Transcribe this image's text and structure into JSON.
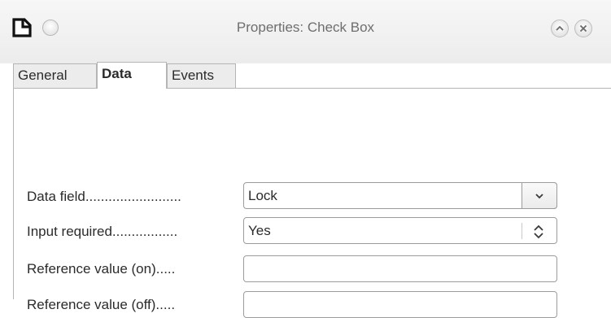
{
  "window": {
    "title": "Properties: Check Box",
    "app_icon": "document-corner-icon",
    "menu_icon": "circle-menu-icon",
    "minimize_icon": "chevron-up-icon",
    "close_icon": "close-icon"
  },
  "tabs": [
    {
      "label": "General",
      "active": false
    },
    {
      "label": "Data",
      "active": true
    },
    {
      "label": "Events",
      "active": false
    }
  ],
  "fields": [
    {
      "label": "Data field.........................",
      "value": "Lock",
      "control": "combobox",
      "icon": "chevron-down-icon"
    },
    {
      "label": "Input required.................",
      "value": "Yes",
      "control": "spinbox",
      "icon": "spin-up-down-icon"
    },
    {
      "label": "Reference value (on).....",
      "value": "",
      "control": "text"
    },
    {
      "label": "Reference value (off).....",
      "value": "",
      "control": "text"
    }
  ]
}
